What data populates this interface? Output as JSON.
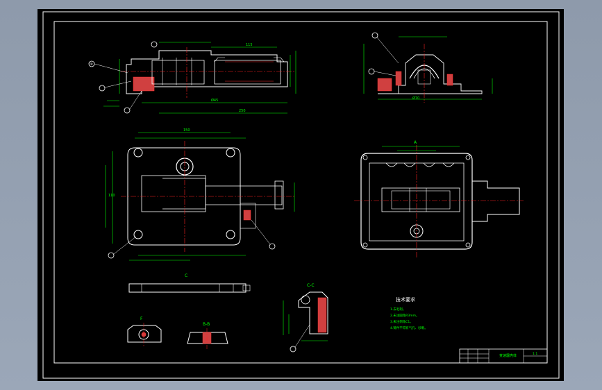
{
  "colors": {
    "background": "#000000",
    "frame": "#ffffff",
    "outline": "#ffffff",
    "dimension": "#00ff00",
    "centerline": "#ff2020",
    "hatch": "#ff2020",
    "hidden": "#ffff00",
    "section_fill": "#ff4040"
  },
  "drawing": {
    "section_cc_label": "C-C",
    "section_bb_label": "B-B",
    "view_a_label": "A",
    "view_c_label": "C",
    "view_f_label": "F",
    "tech_requirements": {
      "title": "技术要求",
      "items": [
        "1.去毛刺。",
        "2.未注圆角R3mm。",
        "3.未注倒角C1。",
        "4.铸件不得有气孔、砂眼。"
      ]
    },
    "title_block": {
      "name": "变速器壳体",
      "scale": "1:1"
    },
    "balloons": [
      "①",
      "②",
      "③",
      "④",
      "⑤",
      "⑥",
      "⑦",
      "⑧"
    ]
  }
}
